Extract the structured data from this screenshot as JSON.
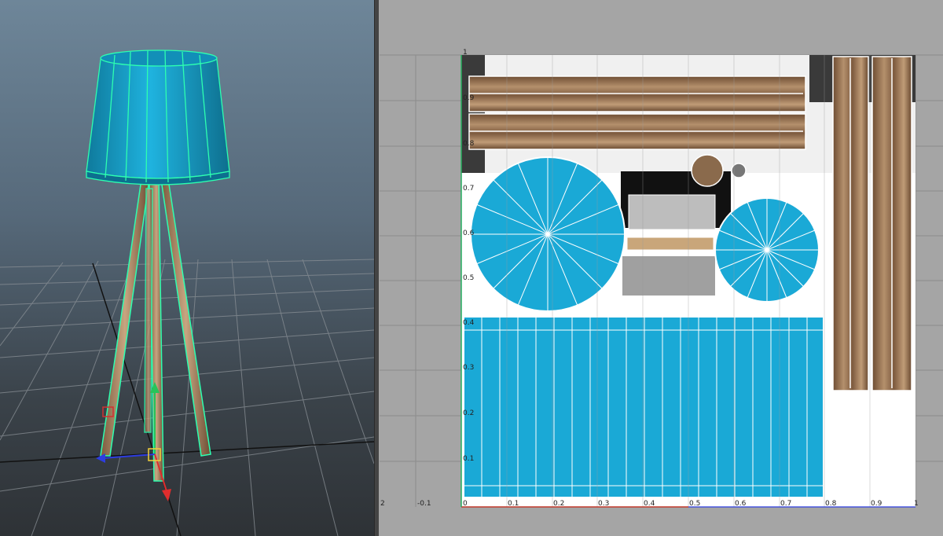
{
  "viewport": {
    "panel": "3D perspective viewport",
    "object": "floor-lamp",
    "grid": true,
    "manipulator": "move"
  },
  "uv_editor": {
    "grid": true,
    "u_ticks": [
      "-0.1",
      "0",
      "0.1",
      "0.2",
      "0.3",
      "0.4",
      "0.5",
      "0.6",
      "0.7",
      "0.8",
      "0.9",
      "1"
    ],
    "v_ticks": [
      "1",
      "0.9",
      "0.8",
      "0.7",
      "0.6",
      "0.5",
      "0.4",
      "0.3",
      "0.2",
      "0.1"
    ],
    "corner_label": "2",
    "shells": [
      "wood-plank-horizontal",
      "shade-top-disc",
      "shade-bottom-disc",
      "shade-side-strip",
      "wood-plank-vertical",
      "hardware-pieces"
    ]
  },
  "colors": {
    "shade": "#1aa9d6",
    "wireframe": "#2dffb0",
    "uv_line": "#ffffff",
    "u_axis": "#c0392b",
    "v_axis": "#27ae60",
    "wood": "#8a6a4c"
  }
}
